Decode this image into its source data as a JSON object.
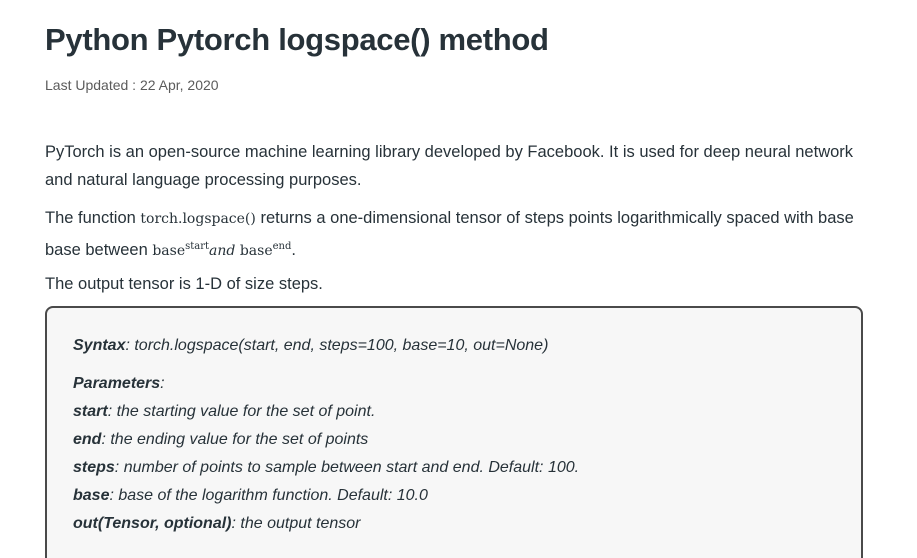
{
  "article": {
    "title": "Python Pytorch logspace() method",
    "last_updated": "Last Updated : 22 Apr, 2020",
    "para1": "PyTorch is an open-source machine learning library developed by Facebook. It is used for deep neural network and natural language processing purposes.",
    "para2_prefix": "The function ",
    "para2_code": "torch.logspace()",
    "para2_middle": " returns a one-dimensional tensor of steps points logarithmically spaced with base base between ",
    "para2_math": {
      "base1": "base",
      "sup1": "start",
      "and": "and",
      "base2": "base",
      "sup2": "end"
    },
    "para2_suffix": ".",
    "para3": "The output tensor is 1-D of size steps."
  },
  "syntax": {
    "syntax_label": "Syntax",
    "syntax_text": ": torch.logspace(start, end, steps=100, base=10, out=None)",
    "params_label": "Parameters",
    "params_colon": ":",
    "params": [
      {
        "name": "start",
        "desc": ": the starting value for the set of point."
      },
      {
        "name": "end",
        "desc": ": the ending value for the set of points"
      },
      {
        "name": "steps",
        "desc": ": number of points to sample between start and end. Default: 100."
      },
      {
        "name": "base",
        "desc": ": base of the logarithm function. Default: 10.0"
      },
      {
        "name": "out(Tensor, optional)",
        "desc": ": the output tensor"
      }
    ]
  }
}
